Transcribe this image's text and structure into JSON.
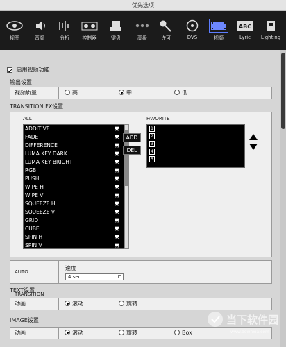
{
  "window": {
    "title": "优先选项"
  },
  "toolbar": {
    "items": [
      {
        "label": "视图",
        "icon": "eye-icon"
      },
      {
        "label": "音频",
        "icon": "speaker-icon"
      },
      {
        "label": "分析",
        "icon": "analysis-icon"
      },
      {
        "label": "控制器",
        "icon": "controller-icon"
      },
      {
        "label": "键盘",
        "icon": "keyboard-icon"
      },
      {
        "label": "高级",
        "icon": "more-icon"
      },
      {
        "label": "许可",
        "icon": "key-icon"
      },
      {
        "label": "DVS",
        "icon": "turntable-icon"
      },
      {
        "label": "视频",
        "icon": "film-icon"
      },
      {
        "label": "Lyric",
        "icon": "abc-icon"
      },
      {
        "label": "Lighting",
        "icon": "lighting-icon"
      }
    ],
    "active_index": 8
  },
  "enable_video": {
    "label": "启用视频功能",
    "checked": true
  },
  "output": {
    "heading": "输出设置",
    "quality_label": "视频质量",
    "options": [
      "高",
      "中",
      "低"
    ],
    "selected": "中"
  },
  "transition_fx": {
    "heading": "TRANSITION FX设置",
    "all_label": "ALL",
    "favorite_label": "FAVORITE",
    "items": [
      "ADDITIVE",
      "FADE",
      "DIFFERENCE",
      "LUMA KEY DARK",
      "LUMA KEY BRIGHT",
      "RGB",
      "PUSH",
      "WIPE H",
      "WIPE V",
      "SQUEEZE H",
      "SQUEEZE V",
      "GRID",
      "CUBE",
      "SPIN H",
      "SPIN V"
    ],
    "add_label": "ADD",
    "del_label": "DEL",
    "favorites": [
      "1",
      "2",
      "3",
      "4",
      "5"
    ]
  },
  "auto_transition": {
    "label": "AUTO TRANSITION",
    "speed_label": "速度",
    "speed_value": "4 sec"
  },
  "text_settings": {
    "heading": "TEXT设置",
    "anim_label": "动画",
    "options": [
      "滚动",
      "旋转"
    ],
    "selected": "滚动"
  },
  "image_settings": {
    "heading": "IMAGE设置",
    "anim_label": "动画",
    "options": [
      "滚动",
      "旋转",
      "Box"
    ],
    "selected": "滚动"
  },
  "watermark": {
    "main": "当下软件园",
    "sub": "www.downxia.com"
  },
  "colors": {
    "toolbar_bg": "#1b1b1b",
    "panel_bg": "#d6d6d6",
    "list_bg": "#000000",
    "accent": "#5c7cff"
  }
}
